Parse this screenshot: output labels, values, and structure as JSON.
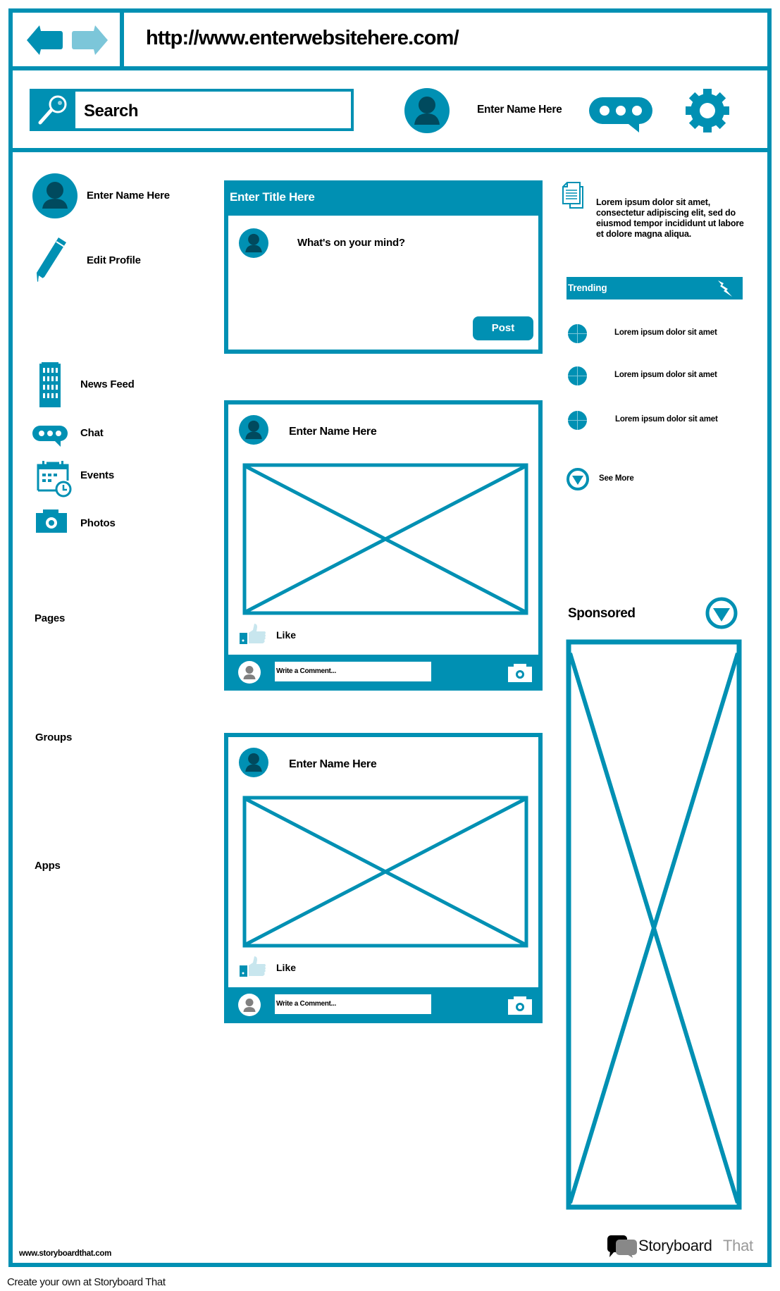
{
  "browser": {
    "url": "http://www.enterwebsitehere.com/",
    "back_icon": "arrow-left-icon",
    "forward_icon": "arrow-right-icon"
  },
  "header": {
    "search_placeholder": "Search",
    "search_icon": "magnifier-icon",
    "user_name": "Enter Name Here",
    "chat_icon": "chat-bubble-icon",
    "settings_icon": "gear-icon"
  },
  "sidebar": {
    "profile_name": "Enter Name Here",
    "edit_profile": "Edit Profile",
    "items": [
      {
        "label": "News Feed",
        "icon": "building-icon"
      },
      {
        "label": "Chat",
        "icon": "chat-bubble-icon"
      },
      {
        "label": "Events",
        "icon": "calendar-clock-icon"
      },
      {
        "label": "Photos",
        "icon": "camera-icon"
      }
    ],
    "sections": [
      "Pages",
      "Groups",
      "Apps"
    ]
  },
  "composer": {
    "title": "Enter Title Here",
    "prompt": "What's on your mind?",
    "post_button": "Post"
  },
  "posts": [
    {
      "author": "Enter Name Here",
      "like_label": "Like",
      "comment_placeholder": "Write a Comment..."
    },
    {
      "author": "Enter Name Here",
      "like_label": "Like",
      "comment_placeholder": "Write a Comment..."
    }
  ],
  "right": {
    "notice_text": "Lorem ipsum dolor sit amet, consectetur adipiscing elit, sed do eiusmod tempor incididunt ut labore et dolore magna aliqua.",
    "trending_title": "Trending",
    "trending_items": [
      "Lorem ipsum dolor sit amet",
      "Lorem ipsum dolor sit amet",
      "Lorem ipsum dolor sit amet"
    ],
    "see_more": "See More",
    "sponsored_title": "Sponsored"
  },
  "footer": {
    "site": "www.storyboardthat.com",
    "logo_main": "Storyboard",
    "logo_light": "That",
    "caption": "Create your own at Storyboard That"
  },
  "colors": {
    "accent": "#0090b3",
    "accent_light": "#7cc6d9",
    "avatar_dark": "#004a5e"
  }
}
